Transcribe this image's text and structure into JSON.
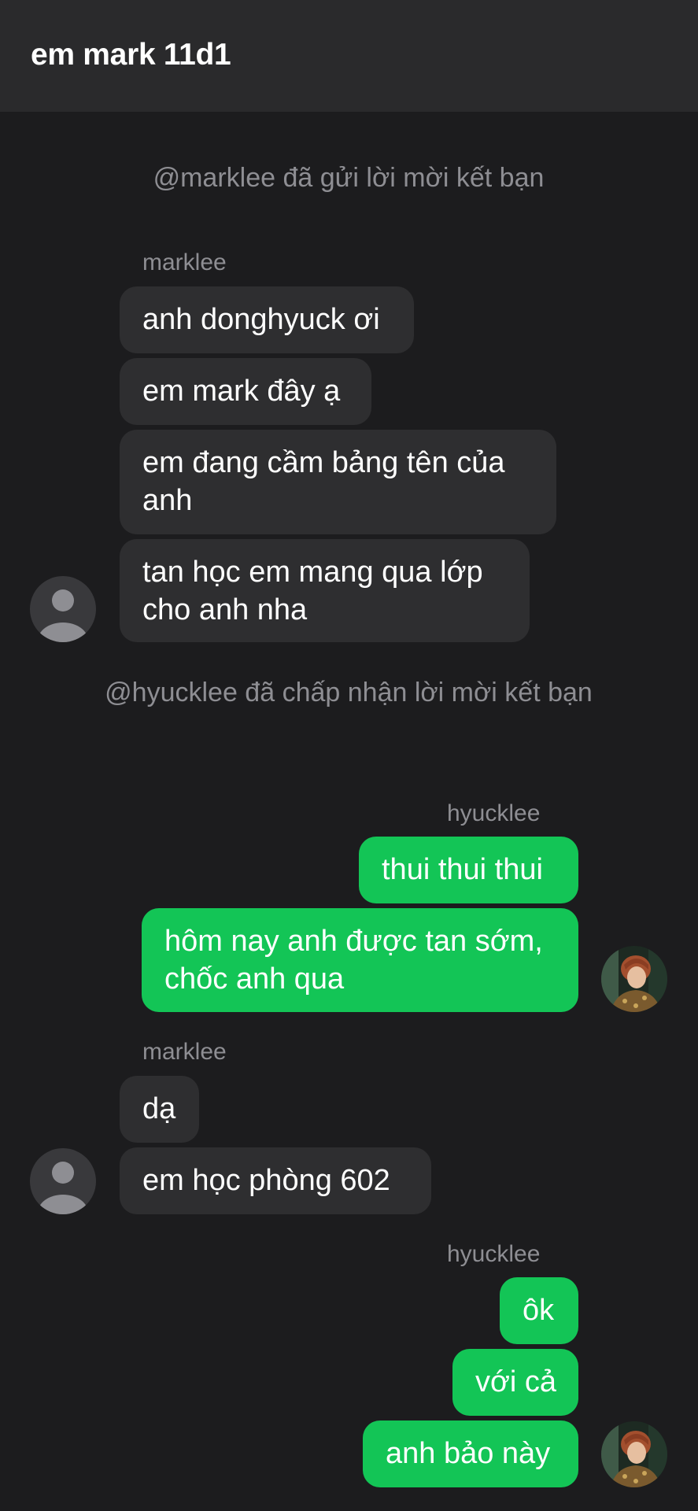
{
  "header": {
    "title": "em mark 11d1"
  },
  "system_messages": [
    "@marklee đã gửi lời mời kết bạn",
    "@hyucklee đã chấp nhận lời mời kết bạn"
  ],
  "groups": [
    {
      "sender": "marklee",
      "direction": "incoming",
      "messages": [
        "anh donghyuck ơi",
        "em mark đây ạ",
        "em đang cầm bảng tên của anh",
        "tan học em mang qua lớp cho anh nha"
      ]
    },
    {
      "sender": "hyucklee",
      "direction": "outgoing",
      "messages": [
        "thui thui thui",
        "hôm nay anh được tan sớm, chốc anh qua"
      ]
    },
    {
      "sender": "marklee",
      "direction": "incoming",
      "messages": [
        "dạ",
        "em học phòng 602"
      ]
    },
    {
      "sender": "hyucklee",
      "direction": "outgoing",
      "messages": [
        "ôk",
        "với cả",
        "anh bảo này"
      ]
    }
  ],
  "colors": {
    "background": "#1c1c1e",
    "header": "#2a2a2c",
    "incoming_bubble": "#2e2e30",
    "outgoing_bubble": "#13c556",
    "meta_text": "#8e8e93"
  },
  "icons": {
    "incoming_avatar": "default-user-avatar",
    "outgoing_avatar": "profile-photo-avatar"
  }
}
